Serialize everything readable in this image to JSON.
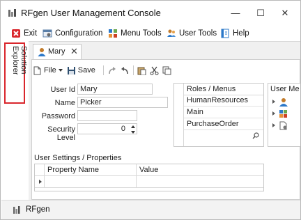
{
  "window": {
    "title": "RFgen User Management Console",
    "controls": {
      "minimize": "—",
      "maximize": "☐",
      "close": "✕"
    }
  },
  "menu": [
    {
      "label": "Exit",
      "icon": "exit-icon"
    },
    {
      "label": "Configuration",
      "icon": "configuration-icon"
    },
    {
      "label": "Menu Tools",
      "icon": "menu-tools-icon"
    },
    {
      "label": "User Tools",
      "icon": "user-tools-icon"
    },
    {
      "label": "Help",
      "icon": "help-icon"
    }
  ],
  "explorer": {
    "label": "Solution Explorer"
  },
  "tab": {
    "label": "Mary",
    "close": "✕"
  },
  "toolbar": {
    "file": "File",
    "save": "Save"
  },
  "form": {
    "user_id_label": "User Id",
    "user_id_value": "Mary",
    "name_label": "Name",
    "name_value": "Picker",
    "password_label": "Password",
    "password_value": "",
    "security_label": "Security Level",
    "security_value": "0"
  },
  "roles": {
    "header": "Roles / Menus",
    "items": [
      "HumanResources",
      "Main",
      "PurchaseOrder"
    ]
  },
  "user_menus": {
    "header": "User Me"
  },
  "settings": {
    "label": "User Settings / Properties",
    "columns": [
      "Property Name",
      "Value"
    ]
  },
  "status": {
    "text": "RFgen"
  },
  "colors": {
    "highlight": "#d9262c",
    "accent": "#1f6fc5"
  }
}
